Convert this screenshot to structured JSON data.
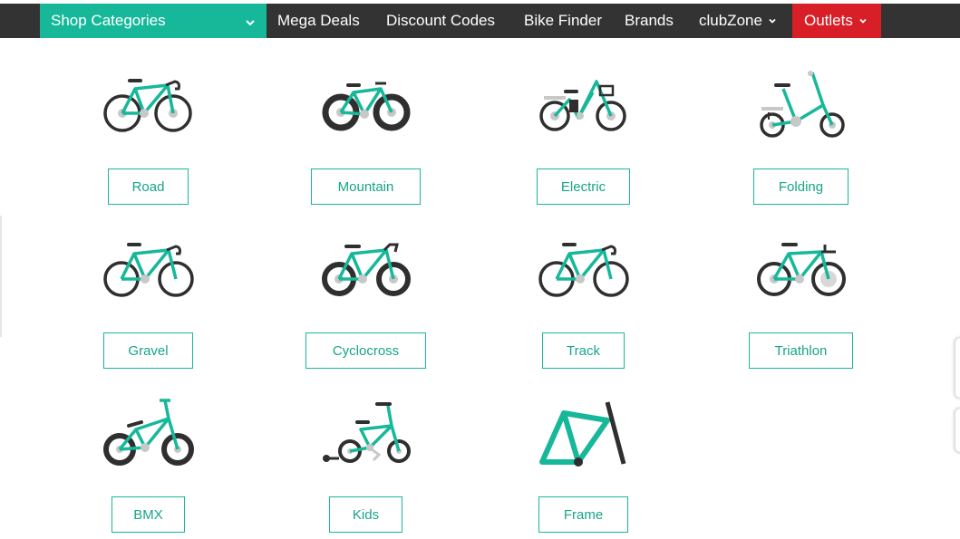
{
  "nav": {
    "shop_categories": "Shop Categories",
    "items": [
      "Mega Deals",
      "Discount Codes",
      "Bike Finder",
      "Brands",
      "clubZone"
    ],
    "outlets": "Outlets"
  },
  "colors": {
    "nav_bg": "#333333",
    "accent": "#17b89a",
    "outlet": "#d81e27",
    "dark": "#2f2f2f",
    "grey": "#c8c8c8"
  },
  "categories": [
    {
      "label": "Road",
      "icon": "road-bike-icon"
    },
    {
      "label": "Mountain",
      "icon": "mountain-bike-icon"
    },
    {
      "label": "Electric",
      "icon": "electric-bike-icon"
    },
    {
      "label": "Folding",
      "icon": "folding-bike-icon"
    },
    {
      "label": "Gravel",
      "icon": "gravel-bike-icon"
    },
    {
      "label": "Cyclocross",
      "icon": "cyclocross-bike-icon"
    },
    {
      "label": "Track",
      "icon": "track-bike-icon"
    },
    {
      "label": "Triathlon",
      "icon": "triathlon-bike-icon"
    },
    {
      "label": "BMX",
      "icon": "bmx-bike-icon"
    },
    {
      "label": "Kids",
      "icon": "kids-bike-icon"
    },
    {
      "label": "Frame",
      "icon": "frame-icon"
    }
  ]
}
